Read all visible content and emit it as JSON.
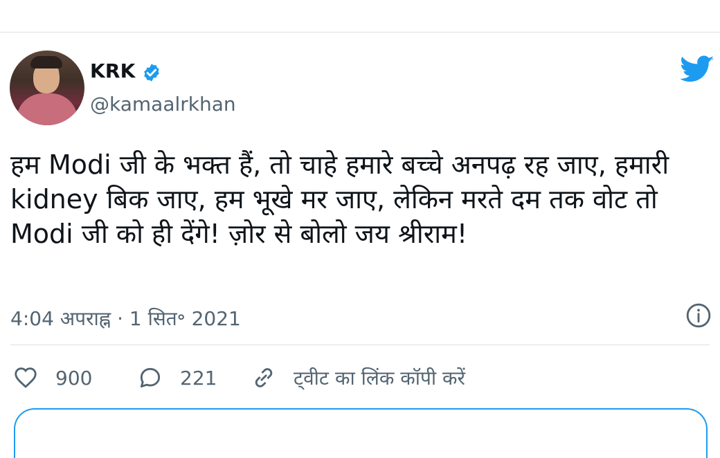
{
  "tweet": {
    "display_name": "KRK",
    "handle": "@kamaalrkhan",
    "text": "हम Modi जी के भक्त हैं, तो चाहे हमारे बच्चे अनपढ़ रह जाए, हमारी kidney बिक जाए, हम भूखे मर जाए, लेकिन मरते दम तक वोट तो Modi जी को ही देंगे! ज़ोर से बोलो जय श्रीराम!",
    "timestamp": "4:04 अपराह्न · 1 सित॰ 2021",
    "likes": "900",
    "replies": "221",
    "copy_link_label": "ट्वीट का लिंक कॉपी करें"
  },
  "icons": {
    "verified": "verified-badge-icon",
    "twitter": "twitter-bird-icon",
    "info": "info-icon",
    "like": "heart-icon",
    "reply": "reply-icon",
    "copy_link": "link-icon"
  },
  "colors": {
    "accent": "#1d9bf0",
    "text": "#0f1419",
    "secondary": "#536471"
  }
}
